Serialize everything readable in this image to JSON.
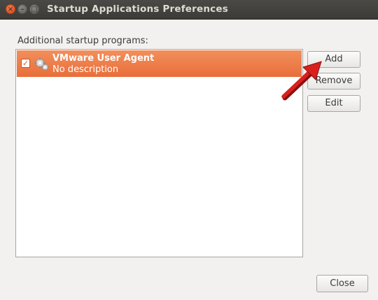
{
  "window": {
    "title": "Startup Applications Preferences",
    "controls": {
      "close": "×",
      "minimize": "–",
      "maximize": "□"
    }
  },
  "list": {
    "label": "Additional startup programs:",
    "items": [
      {
        "name": "VMware User Agent",
        "description": "No description",
        "enabled": true,
        "selected": true
      }
    ]
  },
  "buttons": {
    "add": "Add",
    "remove": "Remove",
    "edit": "Edit",
    "close": "Close"
  },
  "colors": {
    "selection": "#e96e3a",
    "annotation_arrow": "#d9201e",
    "titlebar": "#3c3b37"
  },
  "icons": {
    "row_icon": "gears-icon",
    "annotation": "red-arrow-pointing-to-add"
  }
}
